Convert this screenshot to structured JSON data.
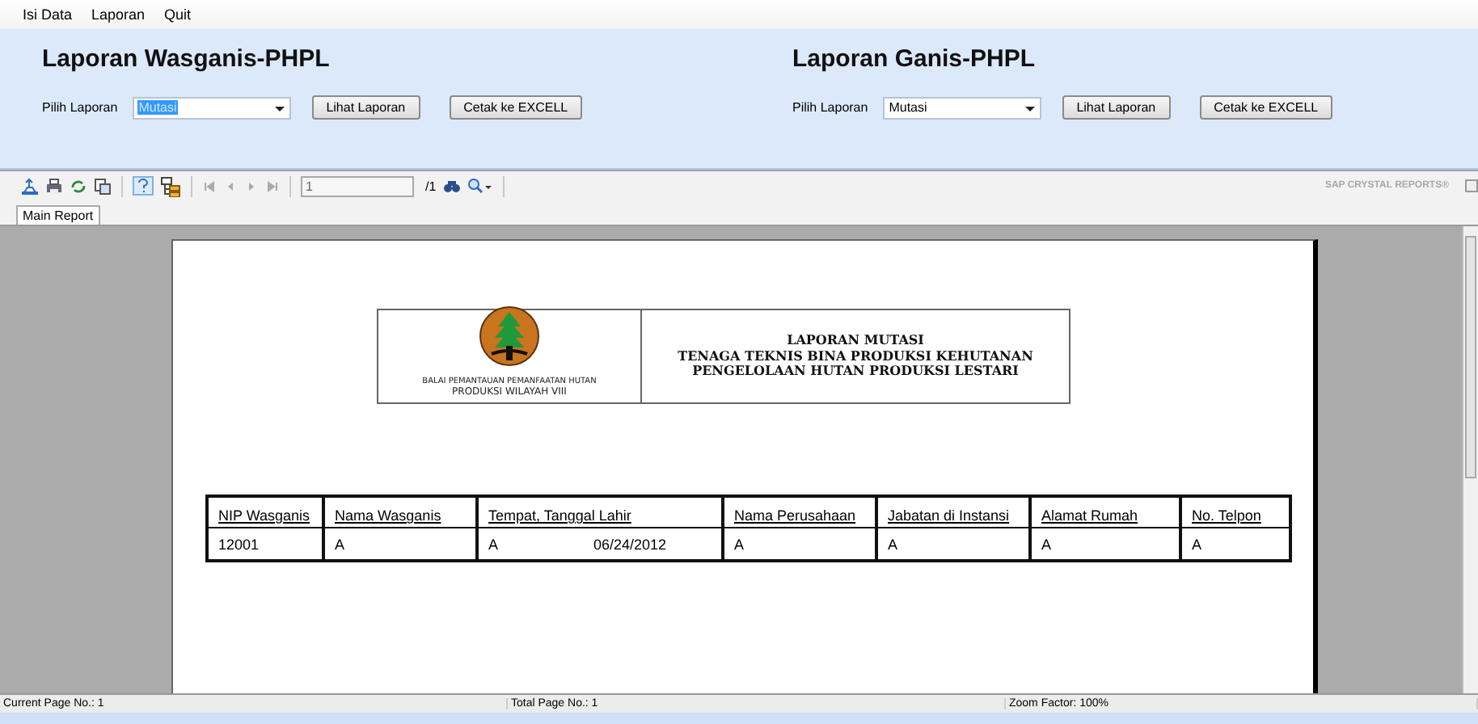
{
  "menu": [
    {
      "label": "Isi Data"
    },
    {
      "label": "Laporan"
    },
    {
      "label": "Quit"
    }
  ],
  "panels": [
    {
      "title": "Laporan Wasganis-PHPL",
      "field_label": "Pilih Laporan",
      "dropdown": {
        "value": "Mutasi",
        "highlighted": true
      },
      "buttons": [
        "Lihat Laporan",
        "Cetak ke EXCELL"
      ]
    },
    {
      "title": "Laporan Ganis-PHPL",
      "field_label": "Pilih Laporan",
      "dropdown": {
        "value": "Mutasi",
        "highlighted": false
      },
      "buttons": [
        "Lihat Laporan",
        "Cetak ke EXCELL"
      ]
    }
  ],
  "toolbar": {
    "page_field": "1",
    "page_total": "/1",
    "brand": "SAP CRYSTAL REPORTS®"
  },
  "tabs": [
    {
      "label": "Main Report",
      "selected": true
    }
  ],
  "report": {
    "org": [
      "BALAI PEMANTAUAN PEMANFAATAN HUTAN",
      "PRODUKSI WILAYAH VIII"
    ],
    "title_lines": [
      "LAPORAN MUTASI",
      "TENAGA TEKNIS BINA PRODUKSI KEHUTANAN",
      "PENGELOLAAN HUTAN PRODUKSI LESTARI"
    ],
    "table": {
      "columns": [
        "NIP Wasganis",
        "Nama Wasganis",
        "Tempat, Tanggal Lahir",
        "Nama Perusahaan",
        "Jabatan di Instansi",
        "Alamat Rumah",
        "No. Telpon"
      ],
      "rows": [
        {
          "cells": [
            "12001",
            "A",
            [
              "A",
              "06/24/2012"
            ],
            "A",
            "A",
            "A",
            "A"
          ]
        }
      ]
    }
  },
  "status": [
    "Current Page No.: 1",
    "Total Page No.: 1",
    "Zoom Factor: 100%"
  ]
}
